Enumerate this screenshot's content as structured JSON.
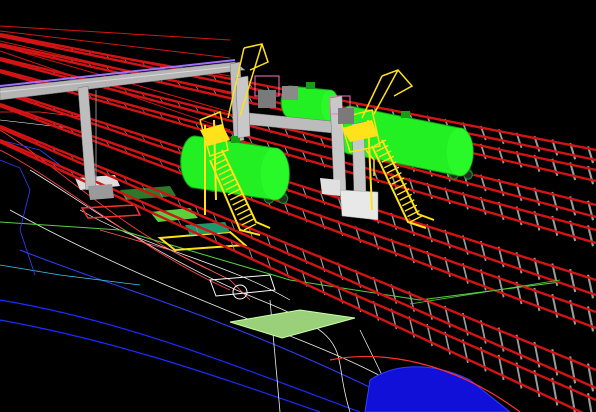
{
  "viewport": {
    "label": "",
    "background": "#000000"
  },
  "colors": {
    "rail": "#d41414",
    "rail_dark": "#8a0a0a",
    "sleeper": "#9a9a9a",
    "tank_car": "#22f022",
    "tank_car_shade": "#14a014",
    "platform": "#ffe21a",
    "gantry": "#c8c8c8",
    "pipe_purple": "#a070ff",
    "contour_blue": "#1c2cff",
    "contour_white": "#f0f0f0",
    "survey_pad": "#9ad07a",
    "ground_green": "#58d040"
  },
  "icons": {
    "tank_car": "tank-car-icon",
    "loading_platform": "loading-platform-icon"
  }
}
